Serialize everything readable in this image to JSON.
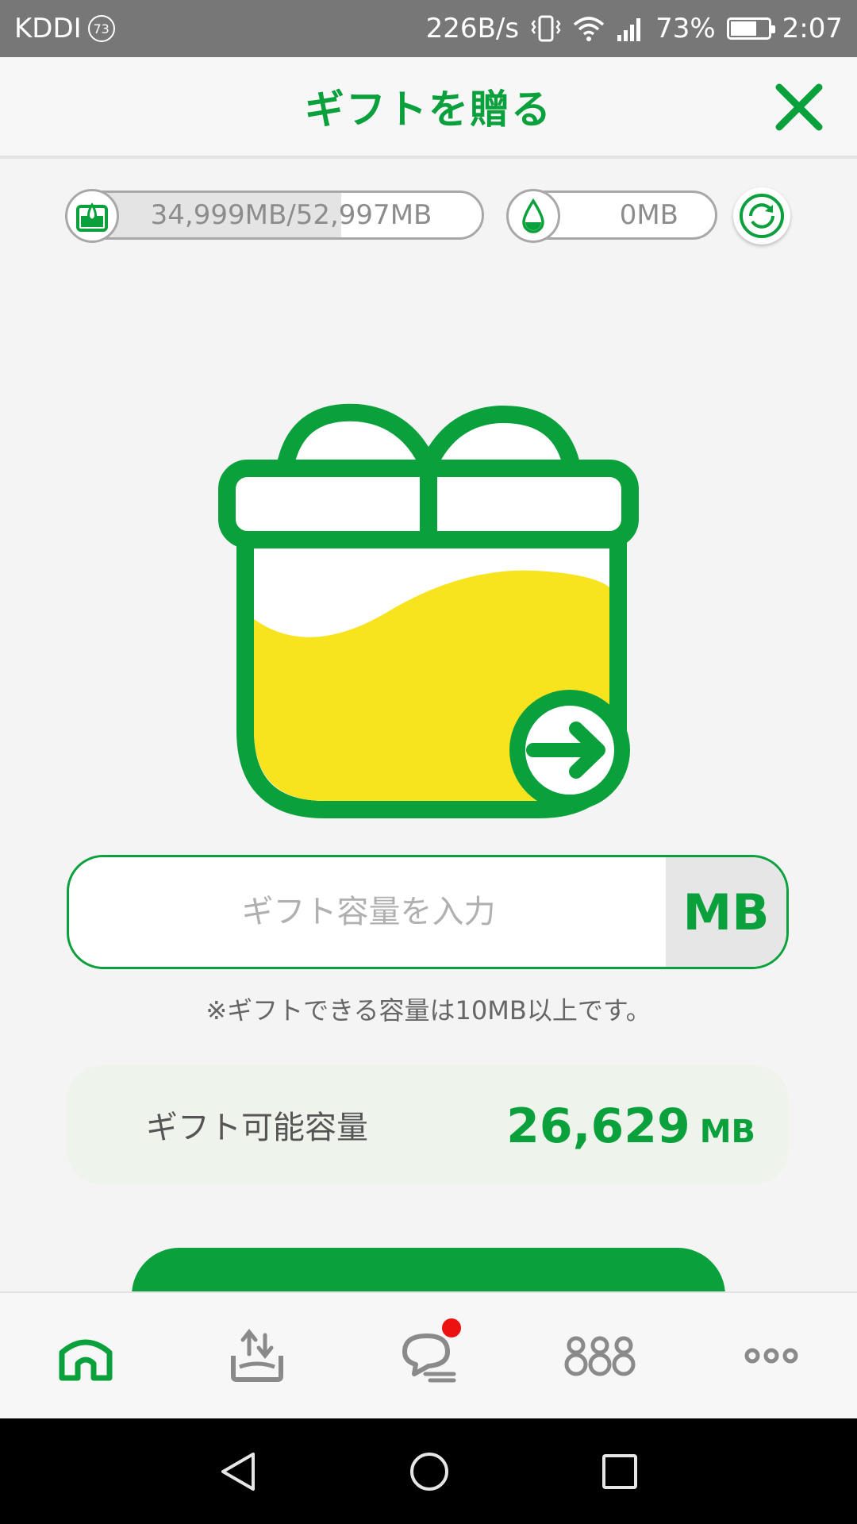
{
  "status_bar": {
    "carrier": "KDDI",
    "carrier_badge": "73",
    "net_speed": "226B/s",
    "battery": "73%",
    "battery_level": 0.73,
    "time": "2:07"
  },
  "header": {
    "title": "ギフトを贈る",
    "close_icon": "close-icon"
  },
  "capacity": {
    "main_text": "34,999MB/52,997MB",
    "main_fraction": 0.66,
    "drop_text": "0MB",
    "main_icon": "water-tank-icon",
    "drop_icon": "water-drop-icon",
    "refresh_icon": "refresh-icon"
  },
  "gift_input": {
    "placeholder": "ギフト容量を入力",
    "unit": "MB",
    "note": "※ギフトできる容量は10MB以上です。"
  },
  "giftable": {
    "label": "ギフト可能容量",
    "value": "26,629",
    "unit": "MB"
  },
  "bottom_nav": {
    "items": [
      "home-icon",
      "share-upload-icon",
      "chat-icon",
      "number-888-icon",
      "more-icon"
    ],
    "notification_on": "chat-icon"
  },
  "colors": {
    "brand_green": "#0aa03c",
    "gift_yellow": "#f7e31e",
    "notification_red": "#ee1111"
  }
}
